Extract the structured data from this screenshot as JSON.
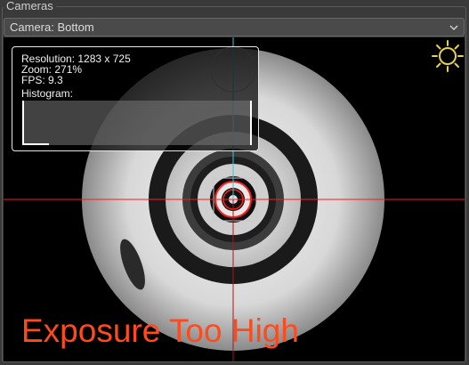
{
  "group": {
    "title": "Cameras"
  },
  "camera_select": {
    "value": "Camera: Bottom"
  },
  "overlay": {
    "resolution": "Resolution: 1283 x 725",
    "zoom": "Zoom: 271%",
    "fps": "FPS: 9.3",
    "histogram_label": "Histogram:"
  },
  "warning": {
    "text": "Exposure Too High",
    "color": "#ff4a1c"
  },
  "colors": {
    "crosshair_horizontal": "#ff1a1a",
    "crosshair_vertical_upper": "#39c6d6",
    "crosshair_vertical_lower": "#b01515",
    "sun_icon": "#e8d24a"
  },
  "icons": {
    "exposure": "sun-icon",
    "dropdown": "chevron-down-icon"
  }
}
